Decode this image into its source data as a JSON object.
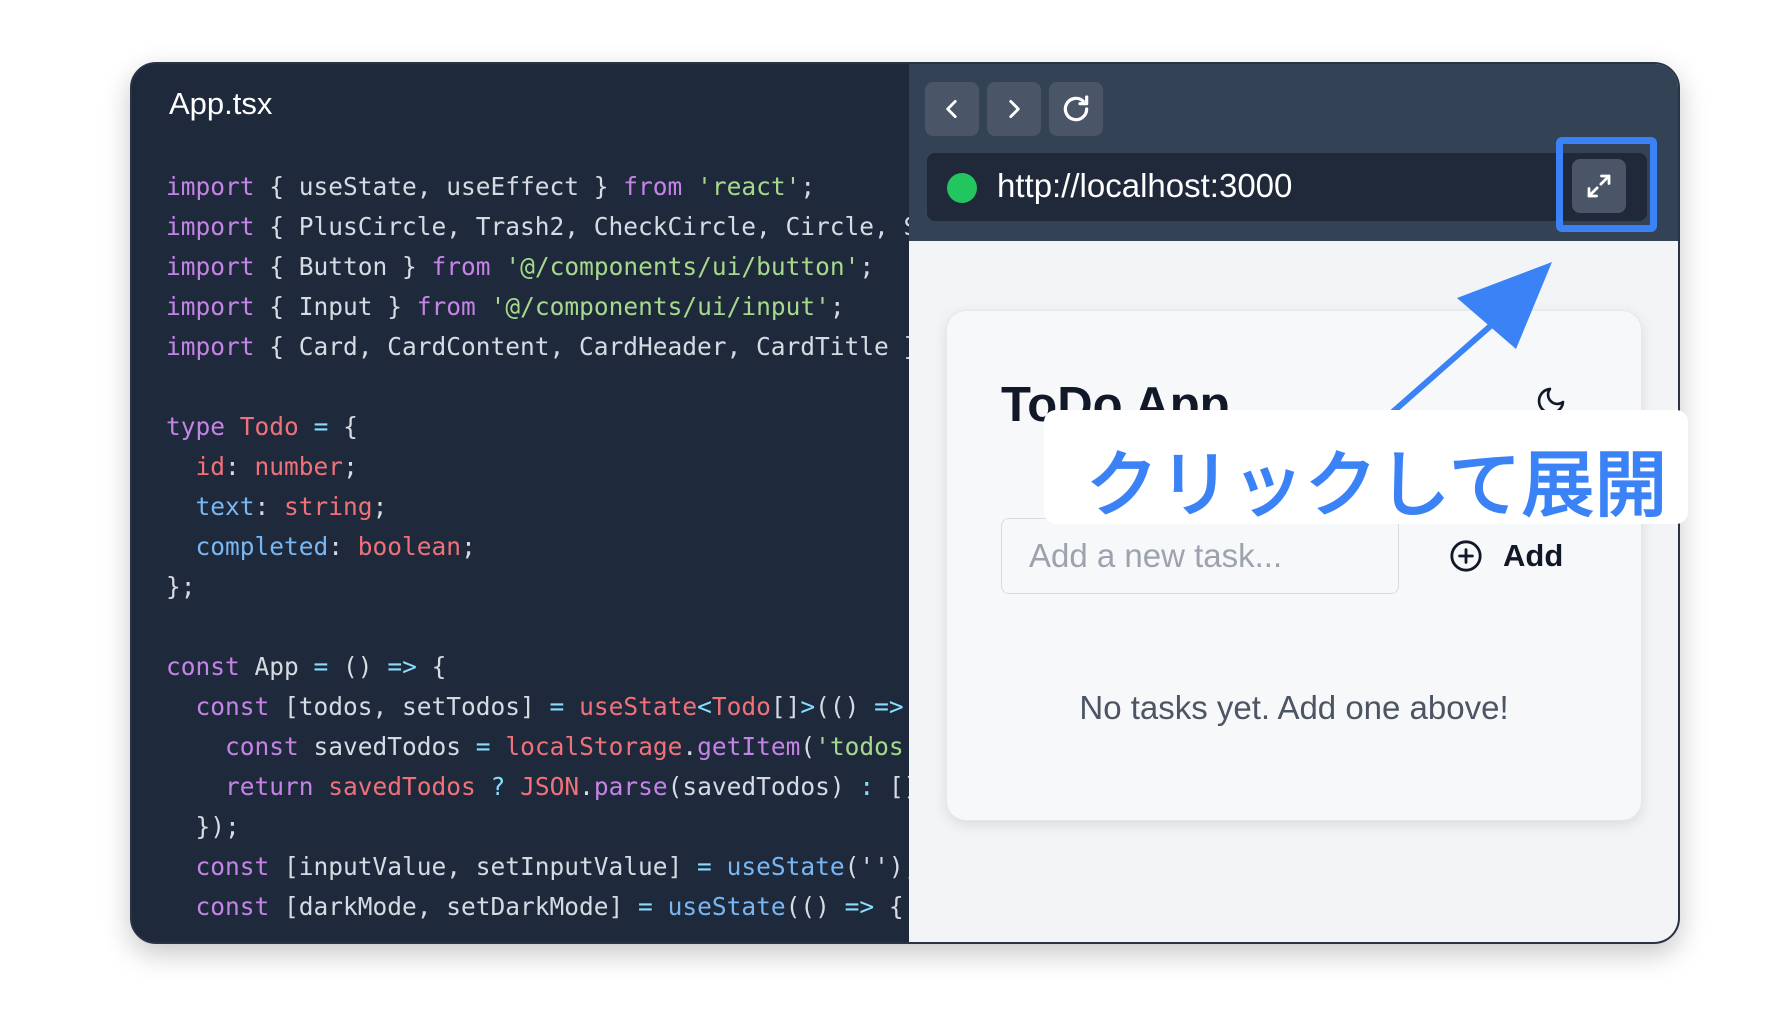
{
  "editor": {
    "filename": "App.tsx",
    "code_lines": [
      [
        [
          "k",
          "import"
        ],
        [
          "c",
          " { useState, useEffect } "
        ],
        [
          "k",
          "from"
        ],
        [
          "c",
          " "
        ],
        [
          "s",
          "'react'"
        ],
        [
          "c",
          ";"
        ]
      ],
      [
        [
          "k",
          "import"
        ],
        [
          "c",
          " { PlusCircle, Trash2, CheckCircle, Circle, S"
        ]
      ],
      [
        [
          "k",
          "import"
        ],
        [
          "c",
          " { Button } "
        ],
        [
          "k",
          "from"
        ],
        [
          "c",
          " "
        ],
        [
          "s",
          "'@/components/ui/button'"
        ],
        [
          "c",
          ";"
        ]
      ],
      [
        [
          "k",
          "import"
        ],
        [
          "c",
          " { Input } "
        ],
        [
          "k",
          "from"
        ],
        [
          "c",
          " "
        ],
        [
          "s",
          "'@/components/ui/input'"
        ],
        [
          "c",
          ";"
        ]
      ],
      [
        [
          "k",
          "import"
        ],
        [
          "c",
          " { Card, CardContent, CardHeader, CardTitle }"
        ]
      ],
      [
        [
          "c",
          ""
        ]
      ],
      [
        [
          "k",
          "type"
        ],
        [
          "c",
          " "
        ],
        [
          "t",
          "Todo"
        ],
        [
          "c",
          " "
        ],
        [
          "p",
          "="
        ],
        [
          "c",
          " {"
        ]
      ],
      [
        [
          "c",
          "  "
        ],
        [
          "t",
          "id"
        ],
        [
          "c",
          ": "
        ],
        [
          "t",
          "number"
        ],
        [
          "c",
          ";"
        ]
      ],
      [
        [
          "c",
          "  "
        ],
        [
          "f",
          "text"
        ],
        [
          "c",
          ": "
        ],
        [
          "t",
          "string"
        ],
        [
          "c",
          ";"
        ]
      ],
      [
        [
          "c",
          "  "
        ],
        [
          "f",
          "completed"
        ],
        [
          "c",
          ": "
        ],
        [
          "t",
          "boolean"
        ],
        [
          "c",
          ";"
        ]
      ],
      [
        [
          "c",
          "};"
        ]
      ],
      [
        [
          "c",
          ""
        ]
      ],
      [
        [
          "k",
          "const"
        ],
        [
          "c",
          " App "
        ],
        [
          "p",
          "="
        ],
        [
          "c",
          " () "
        ],
        [
          "p",
          "=>"
        ],
        [
          "c",
          " {"
        ]
      ],
      [
        [
          "c",
          "  "
        ],
        [
          "k",
          "const"
        ],
        [
          "c",
          " [todos, setTodos] "
        ],
        [
          "p",
          "="
        ],
        [
          "c",
          " "
        ],
        [
          "t",
          "useState"
        ],
        [
          "p",
          "<"
        ],
        [
          "t",
          "Todo"
        ],
        [
          "c",
          "[]"
        ],
        [
          "p",
          ">"
        ],
        [
          "c",
          "(() "
        ],
        [
          "p",
          "=>"
        ]
      ],
      [
        [
          "c",
          "    "
        ],
        [
          "k",
          "const"
        ],
        [
          "c",
          " savedTodos "
        ],
        [
          "p",
          "="
        ],
        [
          "c",
          " "
        ],
        [
          "t",
          "localStorage"
        ],
        [
          "c",
          "."
        ],
        [
          "k",
          "getItem"
        ],
        [
          "c",
          "("
        ],
        [
          "s",
          "'todos'"
        ]
      ],
      [
        [
          "c",
          "    "
        ],
        [
          "k",
          "return"
        ],
        [
          "c",
          " "
        ],
        [
          "t",
          "savedTodos"
        ],
        [
          "c",
          " "
        ],
        [
          "p",
          "?"
        ],
        [
          "c",
          " "
        ],
        [
          "t",
          "JSON"
        ],
        [
          "c",
          "."
        ],
        [
          "k",
          "parse"
        ],
        [
          "c",
          "(savedTodos) "
        ],
        [
          "p",
          ":"
        ],
        [
          "c",
          " []"
        ]
      ],
      [
        [
          "c",
          "  });"
        ]
      ],
      [
        [
          "c",
          "  "
        ],
        [
          "k",
          "const"
        ],
        [
          "c",
          " [inputValue, setInputValue] "
        ],
        [
          "p",
          "="
        ],
        [
          "c",
          " "
        ],
        [
          "f",
          "useState"
        ],
        [
          "c",
          "('');"
        ]
      ],
      [
        [
          "c",
          "  "
        ],
        [
          "k",
          "const"
        ],
        [
          "c",
          " [darkMode, setDarkMode] "
        ],
        [
          "p",
          "="
        ],
        [
          "c",
          " "
        ],
        [
          "f",
          "useState"
        ],
        [
          "c",
          "(() "
        ],
        [
          "p",
          "=>"
        ],
        [
          "c",
          " {"
        ]
      ]
    ]
  },
  "browser": {
    "url": "http://localhost:3000",
    "back_icon": "chevron-left-icon",
    "forward_icon": "chevron-right-icon",
    "reload_icon": "refresh-icon",
    "expand_icon": "expand-icon",
    "status_color": "#22c55e"
  },
  "app": {
    "title": "ToDo App",
    "input_placeholder": "Add a new task...",
    "add_label": "Add",
    "empty_message": "No tasks yet. Add one above!"
  },
  "annotation": {
    "callout_text": "クリックして展開",
    "accent_color": "#3b82f6"
  }
}
